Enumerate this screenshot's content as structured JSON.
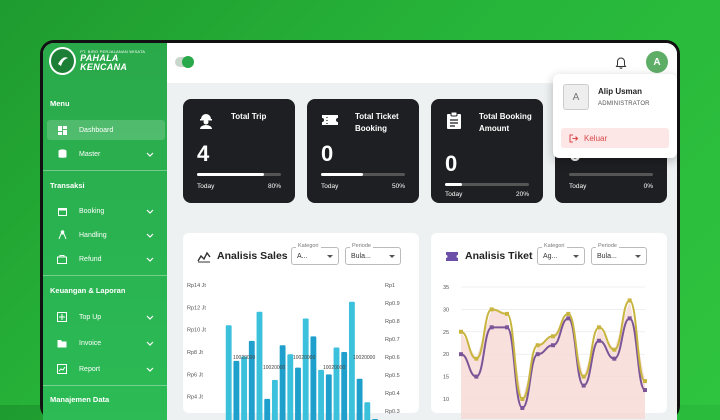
{
  "brand": {
    "small": "PT. BIRO PERJALANAN WISATA",
    "name": "PAHALA KENCANA"
  },
  "sidebar": {
    "sections": [
      {
        "label": "Menu",
        "items": [
          {
            "label": "Dashboard",
            "icon": "dashboard-icon",
            "active": true
          },
          {
            "label": "Master",
            "icon": "database-icon"
          }
        ]
      },
      {
        "label": "Transaksi",
        "items": [
          {
            "label": "Booking",
            "icon": "calendar-icon"
          },
          {
            "label": "Handling",
            "icon": "handling-icon"
          },
          {
            "label": "Refund",
            "icon": "refund-icon"
          }
        ]
      },
      {
        "label": "Keuangan & Laporan",
        "items": [
          {
            "label": "Top Up",
            "icon": "topup-icon"
          },
          {
            "label": "Invoice",
            "icon": "folder-icon"
          },
          {
            "label": "Report",
            "icon": "report-icon"
          }
        ]
      },
      {
        "label": "Manajemen Data",
        "items": []
      }
    ]
  },
  "topbar": {
    "avatar_letter": "A"
  },
  "cards": [
    {
      "title": "Total Trip",
      "value": "4",
      "period": "Today",
      "percent_label": "80%",
      "progress": 0.8,
      "icon": "worker-icon"
    },
    {
      "title": "Total Ticket Booking",
      "value": "0",
      "period": "Today",
      "percent_label": "50%",
      "progress": 0.5,
      "icon": "ticket-icon"
    },
    {
      "title": "Total Booking Amount",
      "value": "0",
      "period": "Today",
      "percent_label": "20%",
      "progress": 0.2,
      "icon": "clipboard-icon"
    },
    {
      "title": "",
      "value": "0",
      "period": "Today",
      "percent_label": "0%",
      "progress": 0,
      "icon": ""
    }
  ],
  "panels": {
    "sales": {
      "title": "Analisis Sales",
      "kategori_label": "Kategori",
      "kategori_value": "A...",
      "periode_label": "Periode",
      "periode_value": "Bula..."
    },
    "tiket": {
      "title": "Analisis Tiket",
      "kategori_label": "Kategori",
      "kategori_value": "Ag...",
      "periode_label": "Periode",
      "periode_value": "Bula..."
    }
  },
  "user_menu": {
    "initial": "A",
    "name": "Alip Usman",
    "role": "ADMINISTRATOR",
    "logout_label": "Keluar"
  },
  "chart_data": [
    {
      "type": "bar",
      "title": "Analisis Sales",
      "y_left_ticks": [
        "Rp4 Jt",
        "Rp6 Jt",
        "Rp8 Jt",
        "Rp10 Jt",
        "Rp12 Jt",
        "Rp14 Jt"
      ],
      "y_right_ticks": [
        "Rp0.3",
        "Rp0.4",
        "Rp0.5",
        "Rp0.6",
        "Rp0.7",
        "Rp0.8",
        "Rp0.9",
        "Rp1"
      ],
      "series": [
        {
          "values": [
            10.4,
            7.6,
            11.6,
            5.5,
            7.8,
            11.0,
            6.4,
            8.4,
            12.5,
            3.5
          ]
        },
        {
          "values": [
            7.2,
            9.0,
            3.8,
            8.6,
            6.6,
            9.4,
            6.0,
            8.0,
            5.6,
            2.0
          ]
        }
      ],
      "annotations": [
        "10020000",
        "10020000",
        "10020000",
        "10020000",
        "10020000"
      ]
    },
    {
      "type": "line",
      "title": "Analisis Tiket",
      "y_ticks": [
        10,
        15,
        20,
        25,
        30,
        35
      ],
      "ylim": [
        10,
        35
      ],
      "series": [
        {
          "color": "#c8b540",
          "values": [
            25,
            19,
            30,
            29,
            10,
            22,
            24,
            29,
            15,
            26,
            21,
            32,
            14
          ]
        },
        {
          "color": "#7b5597",
          "values": [
            20,
            15,
            26,
            26,
            8,
            20,
            22,
            28,
            13,
            23,
            19,
            28,
            12
          ]
        }
      ]
    }
  ]
}
